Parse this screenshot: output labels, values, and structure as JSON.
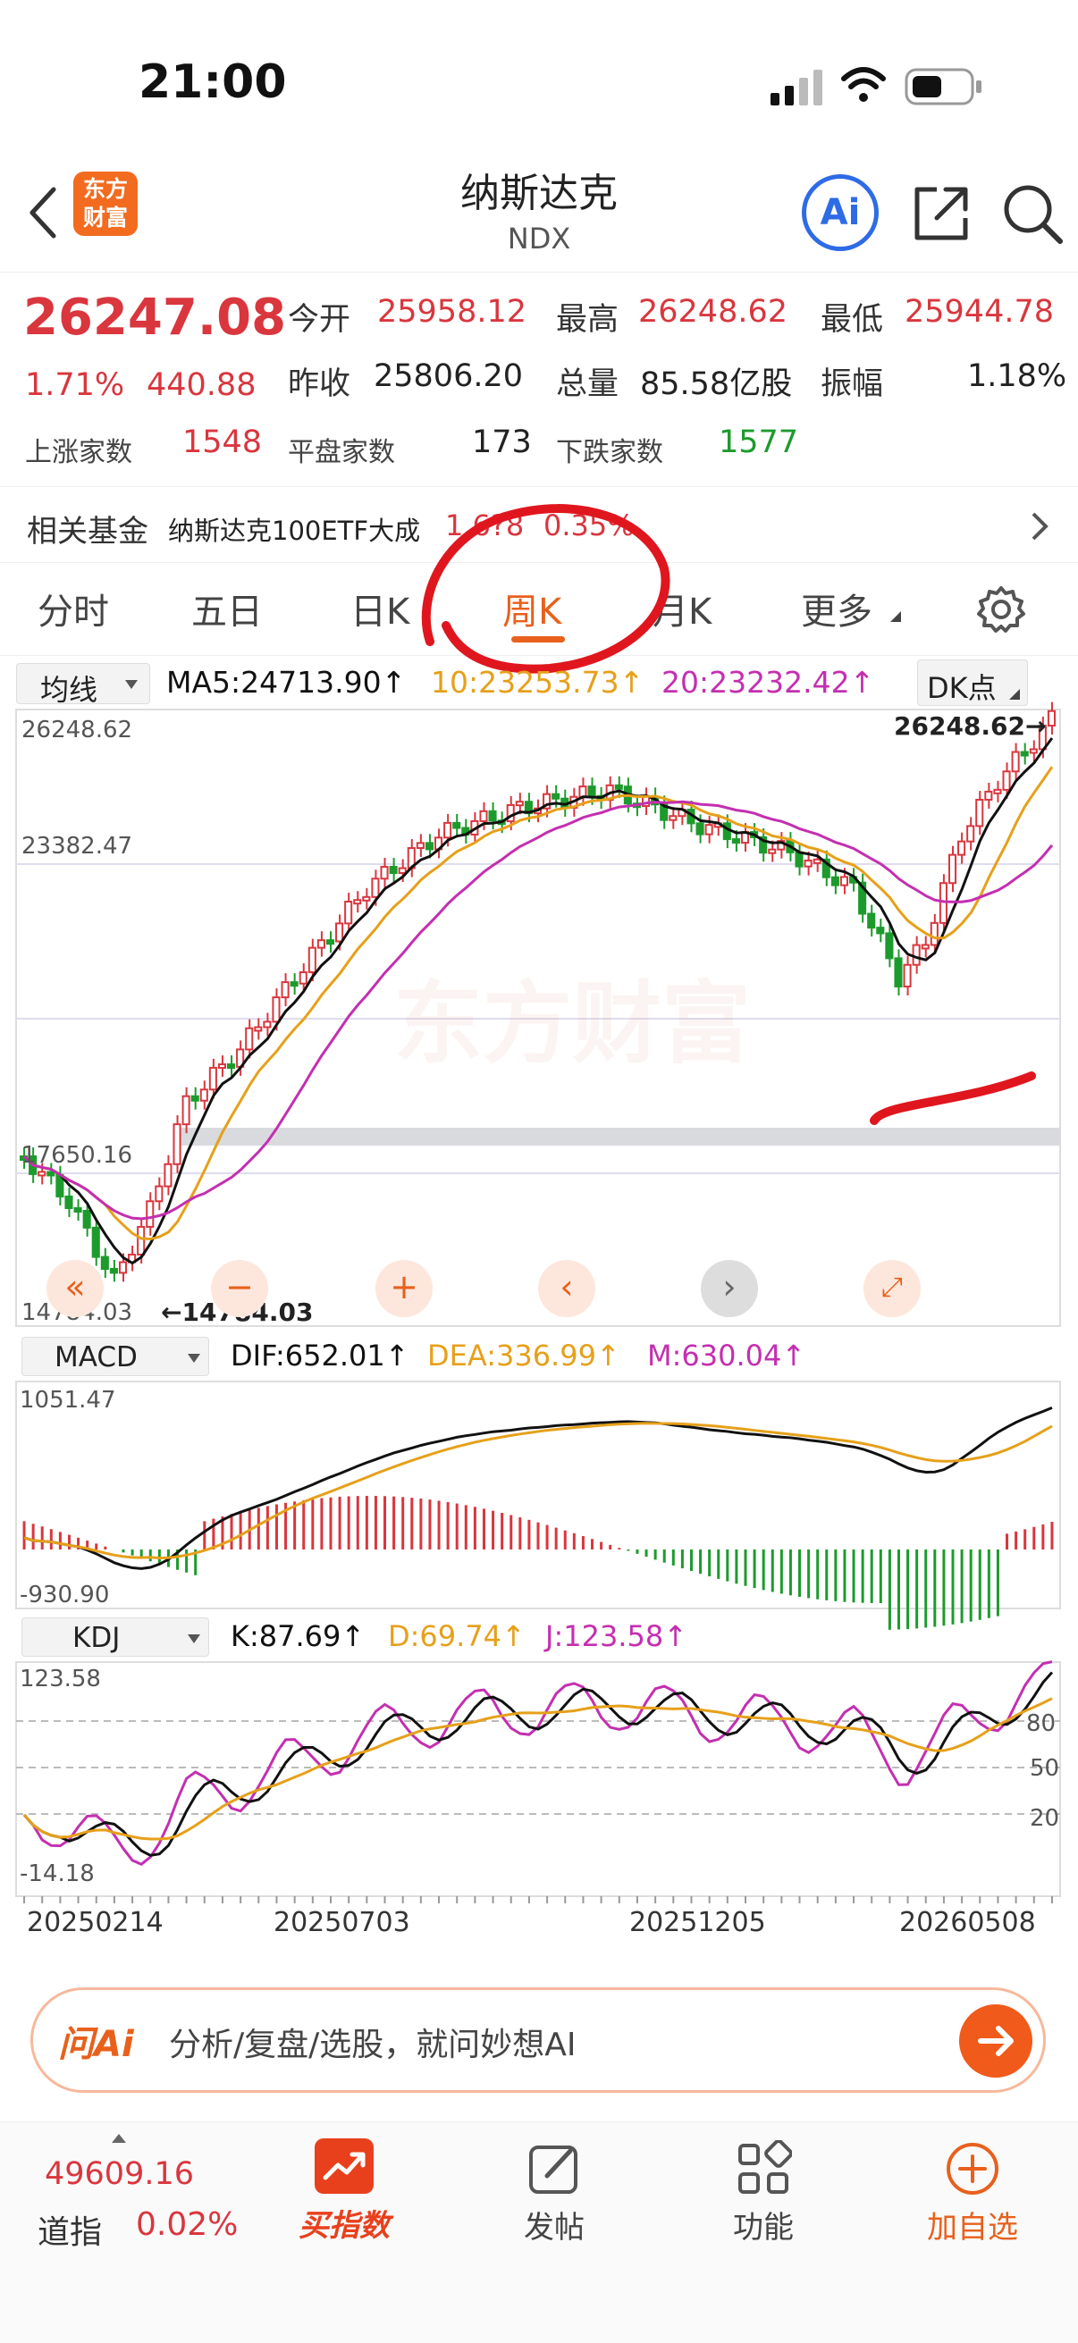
{
  "status": {
    "time": "21:00"
  },
  "header": {
    "title": "纳斯达克",
    "code": "NDX",
    "logo_text_1": "东方",
    "logo_text_2": "财富",
    "ai_label": "Ai"
  },
  "quote": {
    "price": "26247.08",
    "change_pct": "1.71%",
    "change": "440.88",
    "open_label": "今开",
    "open": "25958.12",
    "high_label": "最高",
    "high": "26248.62",
    "low_label": "最低",
    "low": "25944.78",
    "prev_label": "昨收",
    "prev_close": "25806.20",
    "volume_label": "总量",
    "volume": "85.58亿股",
    "amplitude_label": "振幅",
    "amplitude": "1.18%",
    "up_label": "上涨家数",
    "up_count": "1548",
    "flat_label": "平盘家数",
    "flat_count": "173",
    "down_label": "下跌家数",
    "down_count": "1577"
  },
  "fund": {
    "label": "相关基金",
    "name": "纳斯达克100ETF大成",
    "price": "1.6?8",
    "pct": "0.35%"
  },
  "tabs": [
    "分时",
    "五日",
    "日K",
    "周K",
    "月K",
    "更多"
  ],
  "active_tab": "周K",
  "ma": {
    "selector": "均线",
    "ma5": "MA5:24713.90↑",
    "ma10": "10:23253.73↑",
    "ma20": "20:23232.42↑",
    "dk": "DK点"
  },
  "main_chart": {
    "y_labels": [
      "26248.62",
      "23382.47",
      "17650.16",
      "14784.03"
    ],
    "high_marker": "26248.62→",
    "low_marker": "←14784.03",
    "watermark": "东方财富"
  },
  "macd": {
    "selector": "MACD",
    "dif": "DIF:652.01↑",
    "dea": "DEA:336.99↑",
    "m": "M:630.04↑",
    "y_top": "1051.47",
    "y_bottom": "-930.90"
  },
  "kdj": {
    "selector": "KDJ",
    "k": "K:87.69↑",
    "d": "D:69.74↑",
    "j": "J:123.58↑",
    "y_top": "123.58",
    "y_bottom": "-14.18",
    "levels": [
      "80",
      "50",
      "20"
    ]
  },
  "dates": [
    "20250214",
    "20250703",
    "20251205",
    "20260508"
  ],
  "ai_prompt": {
    "brand": "问Ai",
    "placeholder": "分析/复盘/选股，就问妙想AI"
  },
  "bottom_nav": {
    "dji_value": "49609.16",
    "dji_label": "道指",
    "dji_pct": "0.02%",
    "buy_index": "买指数",
    "post": "发帖",
    "function": "功能",
    "add_watch": "加自选"
  },
  "colors": {
    "up": "#d9363e",
    "down": "#1c9b2c",
    "accent": "#e8601c",
    "ma5": "#111111",
    "ma10": "#e6a01a",
    "ma20": "#c42fb0"
  }
}
